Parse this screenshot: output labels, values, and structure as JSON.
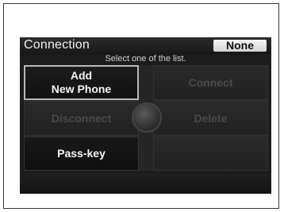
{
  "screen": {
    "title": "Connection",
    "status_value": "None",
    "instruction": "Select one of the list."
  },
  "menu": {
    "add_new_phone": "Add\nNew Phone",
    "connect": "Connect",
    "disconnect": "Disconnect",
    "delete": "Delete",
    "pass_key": "Pass-key"
  }
}
